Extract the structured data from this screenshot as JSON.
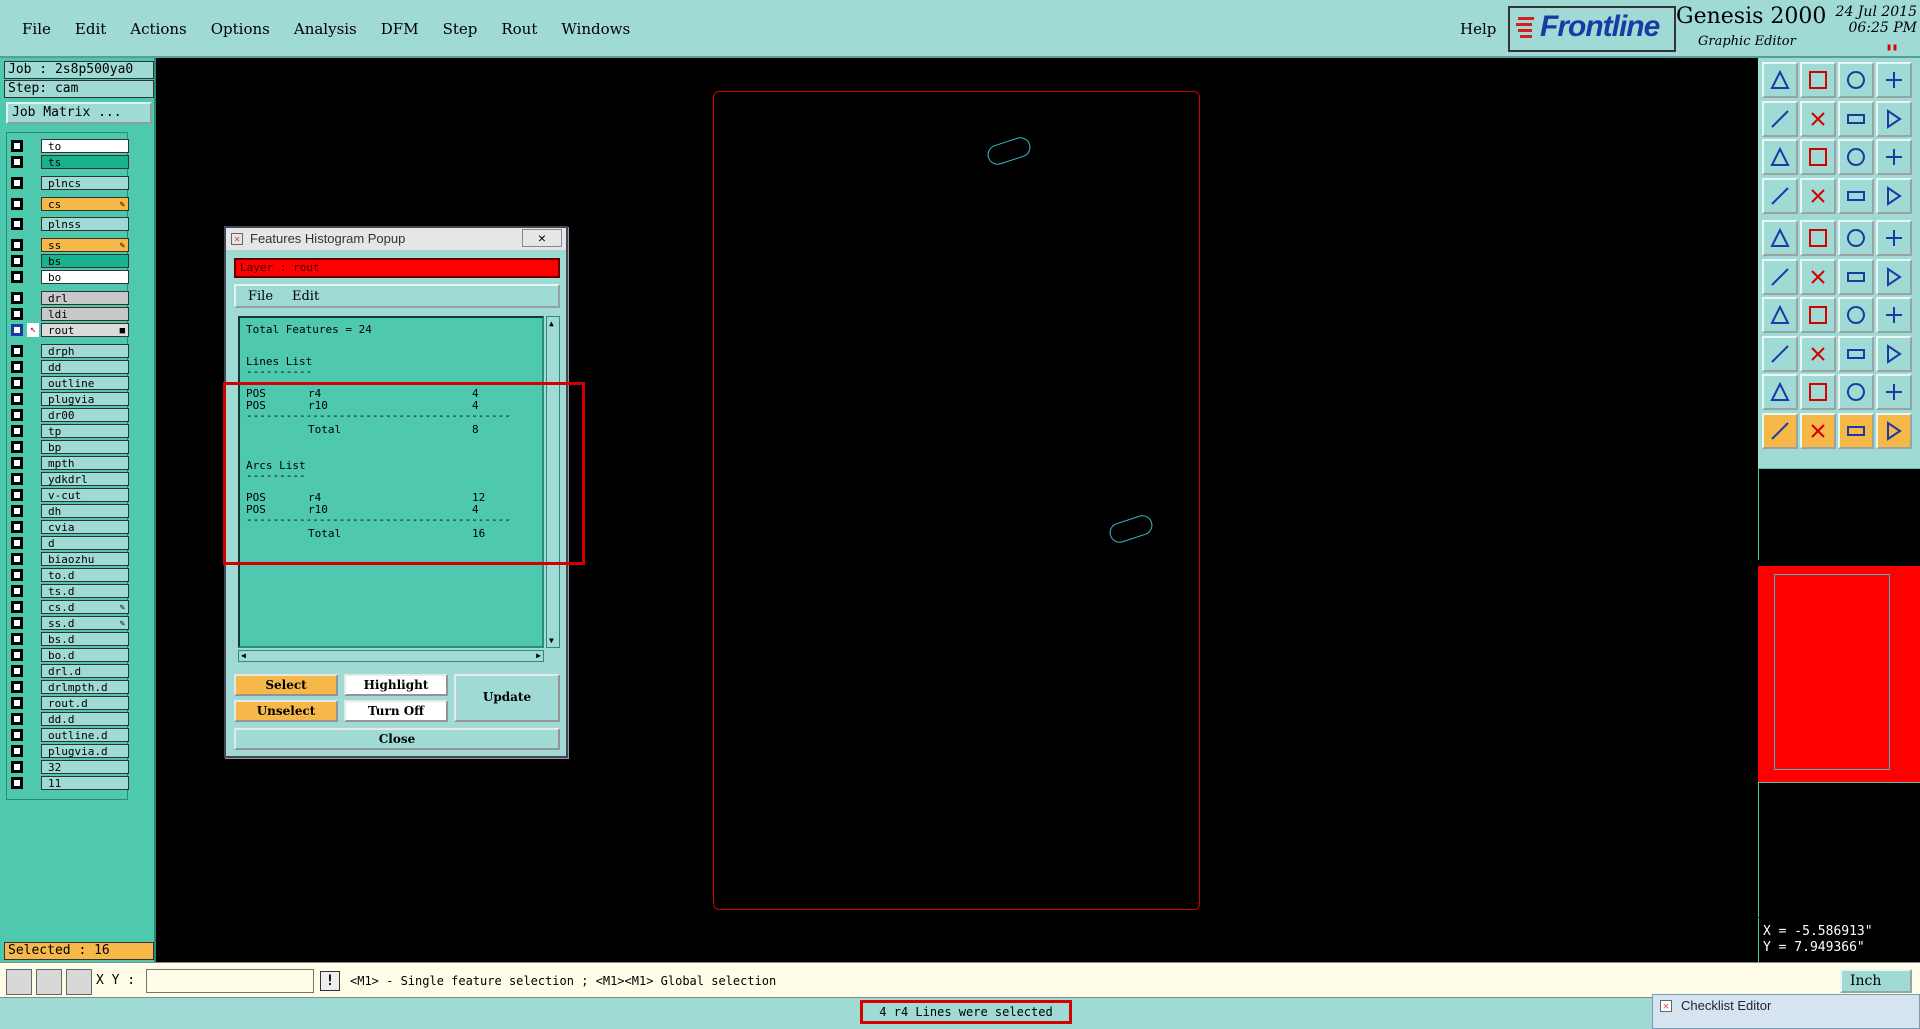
{
  "menu": {
    "items": [
      "File",
      "Edit",
      "Actions",
      "Options",
      "Analysis",
      "DFM",
      "Step",
      "Rout",
      "Windows"
    ],
    "help": "Help"
  },
  "branding": {
    "logo": "Frontline",
    "product": "Genesis 2000",
    "subtitle": "Graphic Editor",
    "date": "24 Jul 2015",
    "time": "06:25 PM"
  },
  "job": {
    "job_label": "Job : 2s8p500ya0",
    "step_label": "Step: cam",
    "matrix_button": "Job Matrix ..."
  },
  "layers": [
    {
      "name": "to",
      "color": "#ffffff"
    },
    {
      "name": "ts",
      "color": "#18b38c"
    },
    {
      "name": "plncs",
      "color": "#9fdad4"
    },
    {
      "name": "cs",
      "color": "#f7b84a",
      "tag": "✎"
    },
    {
      "name": "plnss",
      "color": "#9fdad4"
    },
    {
      "name": "ss",
      "color": "#f7b84a",
      "tag": "✎"
    },
    {
      "name": "bs",
      "color": "#18b38c"
    },
    {
      "name": "bo",
      "color": "#ffffff"
    },
    {
      "name": "drl",
      "color": "#c9c9c9"
    },
    {
      "name": "ldi",
      "color": "#c9c9c9"
    },
    {
      "name": "rout",
      "color": "#dcdcdc",
      "tag": "■",
      "active": true
    },
    {
      "name": "drph",
      "color": "#9fdad4"
    },
    {
      "name": "dd",
      "color": "#9fdad4"
    },
    {
      "name": "outline",
      "color": "#9fdad4"
    },
    {
      "name": "plugvia",
      "color": "#9fdad4"
    },
    {
      "name": "dr00",
      "color": "#9fdad4"
    },
    {
      "name": "tp",
      "color": "#9fdad4"
    },
    {
      "name": "bp",
      "color": "#9fdad4"
    },
    {
      "name": "mpth",
      "color": "#9fdad4"
    },
    {
      "name": "ydkdrl",
      "color": "#9fdad4"
    },
    {
      "name": "v-cut",
      "color": "#9fdad4"
    },
    {
      "name": "dh",
      "color": "#9fdad4"
    },
    {
      "name": "cvia",
      "color": "#9fdad4"
    },
    {
      "name": "d",
      "color": "#9fdad4"
    },
    {
      "name": "biaozhu",
      "color": "#9fdad4"
    },
    {
      "name": "to.d",
      "color": "#9fdad4"
    },
    {
      "name": "ts.d",
      "color": "#9fdad4"
    },
    {
      "name": "cs.d",
      "color": "#9fdad4",
      "tag": "✎"
    },
    {
      "name": "ss.d",
      "color": "#9fdad4",
      "tag": "✎"
    },
    {
      "name": "bs.d",
      "color": "#9fdad4"
    },
    {
      "name": "bo.d",
      "color": "#9fdad4"
    },
    {
      "name": "drl.d",
      "color": "#9fdad4"
    },
    {
      "name": "drlmpth.d",
      "color": "#9fdad4"
    },
    {
      "name": "rout.d",
      "color": "#9fdad4"
    },
    {
      "name": "dd.d",
      "color": "#9fdad4"
    },
    {
      "name": "outline.d",
      "color": "#9fdad4"
    },
    {
      "name": "plugvia.d",
      "color": "#9fdad4"
    },
    {
      "name": "32",
      "color": "#9fdad4"
    },
    {
      "name": "11",
      "color": "#9fdad4"
    }
  ],
  "selected_count": "Selected : 16",
  "popup": {
    "title": "Features Histogram Popup",
    "close_glyph": "×",
    "layer_label": "Layer :  rout",
    "menu_file": "File",
    "menu_edit": "Edit",
    "total_features": "Total Features = 24",
    "lines_header": "Lines List",
    "lines_underline": "----------",
    "lines": [
      {
        "pol": "POS",
        "sym": "r4",
        "count": "4"
      },
      {
        "pol": "POS",
        "sym": "r10",
        "count": "4"
      }
    ],
    "separator": "----------------------------------------",
    "total_label": "Total",
    "lines_total": "8",
    "arcs_header": "Arcs List",
    "arcs_underline": "---------",
    "arcs": [
      {
        "pol": "POS",
        "sym": "r4",
        "count": "12"
      },
      {
        "pol": "POS",
        "sym": "r10",
        "count": "4"
      }
    ],
    "arcs_total": "16",
    "buttons": {
      "select": "Select",
      "highlight": "Highlight",
      "unselect": "Unselect",
      "turn_off": "Turn Off",
      "update": "Update",
      "close": "Close"
    }
  },
  "coords": {
    "x": "X = -5.586913\"",
    "y": "Y = 7.949366\""
  },
  "bottom": {
    "xy_label": "X Y :",
    "xy_value": "",
    "hint": "<M1> - Single feature selection ; <M1><M1> Global selection",
    "unit": "Inch",
    "status": "4 r4 Lines were selected"
  },
  "checklist": {
    "title": "Checklist Editor"
  },
  "colors": {
    "panel_teal": "#4fc9ad",
    "light_teal": "#9fdad4",
    "board_outline": "#d40000",
    "slot": "#3fb8c9",
    "highlight": "#d40000"
  }
}
